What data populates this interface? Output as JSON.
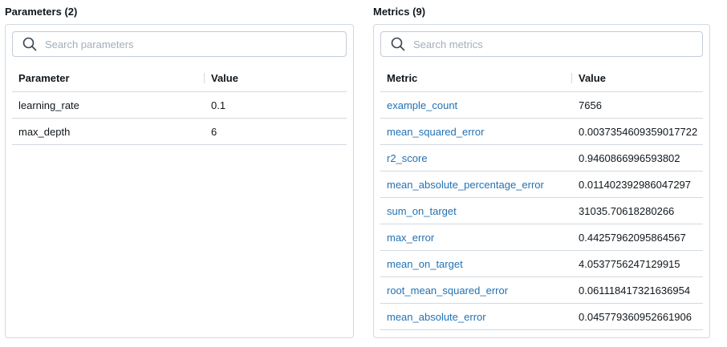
{
  "parameters": {
    "title": "Parameters (2)",
    "search_placeholder": "Search parameters",
    "headers": {
      "name": "Parameter",
      "value": "Value"
    },
    "rows": [
      {
        "name": "learning_rate",
        "value": "0.1"
      },
      {
        "name": "max_depth",
        "value": "6"
      }
    ]
  },
  "metrics": {
    "title": "Metrics (9)",
    "search_placeholder": "Search metrics",
    "headers": {
      "name": "Metric",
      "value": "Value"
    },
    "rows": [
      {
        "name": "example_count",
        "value": "7656"
      },
      {
        "name": "mean_squared_error",
        "value": "0.0037354609359017722"
      },
      {
        "name": "r2_score",
        "value": "0.9460866996593802"
      },
      {
        "name": "mean_absolute_percentage_error",
        "value": "0.011402392986047297"
      },
      {
        "name": "sum_on_target",
        "value": "31035.70618280266"
      },
      {
        "name": "max_error",
        "value": "0.44257962095864567"
      },
      {
        "name": "mean_on_target",
        "value": "4.0537756247129915"
      },
      {
        "name": "root_mean_squared_error",
        "value": "0.061118417321636954"
      },
      {
        "name": "mean_absolute_error",
        "value": "0.045779360952661906"
      }
    ]
  },
  "icons": {
    "search": "search-icon"
  },
  "colors": {
    "link": "#2272b4",
    "border": "#d1d9e1",
    "placeholder": "#a3aeb8"
  }
}
